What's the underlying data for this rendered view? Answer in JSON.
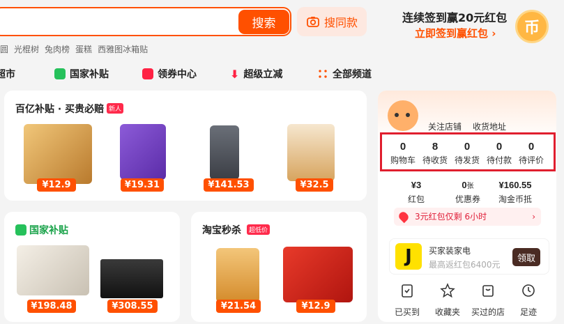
{
  "search": {
    "button_label": "搜索",
    "image_search_label": "搜同款",
    "hot_words": [
      "圆",
      "光棍树",
      "兔肉榜",
      "蛋糕",
      "西雅图冰箱贴"
    ]
  },
  "signin": {
    "title": "连续签到赢20元红包",
    "link": "立即签到赢红包 ›",
    "coin_glyph": "币"
  },
  "nav": [
    {
      "label": "超市",
      "icon": "supermarket-icon",
      "color": "#ff5000"
    },
    {
      "label": "国家补贴",
      "icon": "national-subsidy-icon",
      "color": "#26c15b"
    },
    {
      "label": "领券中心",
      "icon": "coupon-icon",
      "color": "#ff2244"
    },
    {
      "label": "超级立减",
      "icon": "down-arrow-icon",
      "color": "#ff2244"
    },
    {
      "label": "全部频道",
      "icon": "grid-icon",
      "color": "#ff5000"
    }
  ],
  "cards": {
    "subsidy": {
      "title": "百亿补贴 · 买贵必赔",
      "badge": "新人",
      "prices": [
        "¥12.9",
        "¥19.31",
        "¥141.53",
        "¥32.5"
      ]
    },
    "national": {
      "title": "国家补贴",
      "prices": [
        "¥198.48",
        "¥308.55"
      ]
    },
    "flash": {
      "title": "淘宝秒杀",
      "badge": "超低价",
      "prices": [
        "¥21.54",
        "¥12.9"
      ]
    }
  },
  "user": {
    "follow_store": "关注店铺",
    "address": "收货地址",
    "stats": [
      {
        "value": "0",
        "label": "购物车"
      },
      {
        "value": "8",
        "label": "待收货"
      },
      {
        "value": "0",
        "label": "待发货"
      },
      {
        "value": "0",
        "label": "待付款"
      },
      {
        "value": "0",
        "label": "待评价"
      }
    ],
    "assets": [
      {
        "value": "¥3",
        "unit": "",
        "label": "红包"
      },
      {
        "value": "0",
        "unit": "张",
        "label": "优惠券"
      },
      {
        "value": "¥160.55",
        "unit": "",
        "label": "淘金币抵"
      }
    ],
    "redpack_notice": "3元红包仅剩 6小时",
    "promo": {
      "title": "买家装家电",
      "subtitle": "最高返红包6400元",
      "button": "领取",
      "logo_glyph": "J"
    },
    "quick_links": [
      {
        "label": "已买到",
        "icon": "clipboard-icon"
      },
      {
        "label": "收藏夹",
        "icon": "star-icon"
      },
      {
        "label": "买过的店",
        "icon": "store-icon"
      },
      {
        "label": "足迹",
        "icon": "clock-icon"
      }
    ]
  },
  "colors": {
    "accent": "#ff5000",
    "highlight_border": "#e01e2e"
  }
}
